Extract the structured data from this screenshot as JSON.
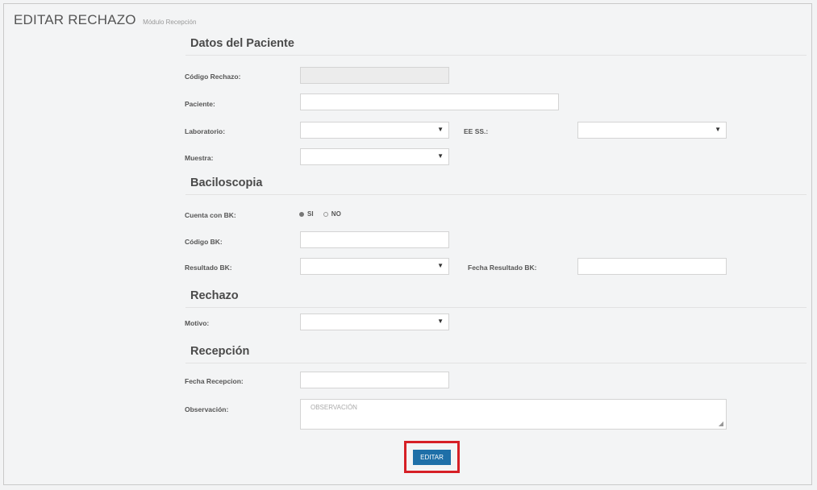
{
  "header": {
    "title": "EDITAR RECHAZO",
    "subtitle": "Módulo Recepción"
  },
  "sections": {
    "patient": "Datos del Paciente",
    "bk": "Baciloscopia",
    "rejection": "Rechazo",
    "reception": "Recepción"
  },
  "fields": {
    "codigo_rechazo": {
      "label": "Código Rechazo:",
      "value": ""
    },
    "paciente": {
      "label": "Paciente:",
      "value": ""
    },
    "laboratorio": {
      "label": "Laboratorio:",
      "value": ""
    },
    "ee_ss": {
      "label": "EE SS.:",
      "value": ""
    },
    "muestra": {
      "label": "Muestra:",
      "value": ""
    },
    "cuenta_bk": {
      "label": "Cuenta con BK:",
      "options": [
        "SI",
        "NO"
      ],
      "selected": "SI"
    },
    "codigo_bk": {
      "label": "Código BK:",
      "value": ""
    },
    "resultado_bk": {
      "label": "Resultado BK:",
      "value": ""
    },
    "fecha_resultado_bk": {
      "label": "Fecha Resultado BK:",
      "value": ""
    },
    "motivo": {
      "label": "Motivo:",
      "value": ""
    },
    "fecha_recepcion": {
      "label": "Fecha Recepcion:",
      "value": ""
    },
    "observacion": {
      "label": "Observación:",
      "placeholder": "OBSERVACIÓN",
      "value": ""
    }
  },
  "actions": {
    "edit_label": "EDITAR"
  },
  "colors": {
    "primary_button": "#1e6fa8",
    "highlight": "#d61f26"
  },
  "icons": {
    "select_caret": "▼",
    "resize_grip": "◢"
  }
}
